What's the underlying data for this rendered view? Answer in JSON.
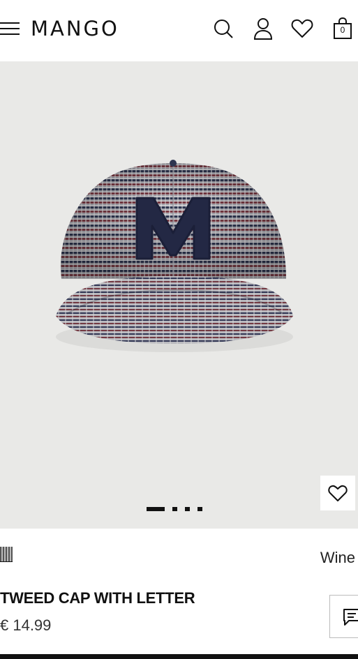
{
  "header": {
    "brand": "MANGO",
    "bag_count": "0",
    "icons": [
      "menu-icon",
      "search-icon",
      "account-icon",
      "heart-icon",
      "shopping-bag-icon"
    ]
  },
  "gallery": {
    "image_count": 4,
    "active_index": 0,
    "favourite_icon": "heart-icon"
  },
  "product": {
    "color_name": "Wine",
    "title": "TWEED CAP WITH LETTER",
    "price": "€ 14.99",
    "chat_icon": "chat-icon"
  },
  "colors": {
    "background": "#e9e9e7",
    "text": "#111111",
    "cap_navy": "#232844",
    "cap_wine": "#7a3a44"
  }
}
